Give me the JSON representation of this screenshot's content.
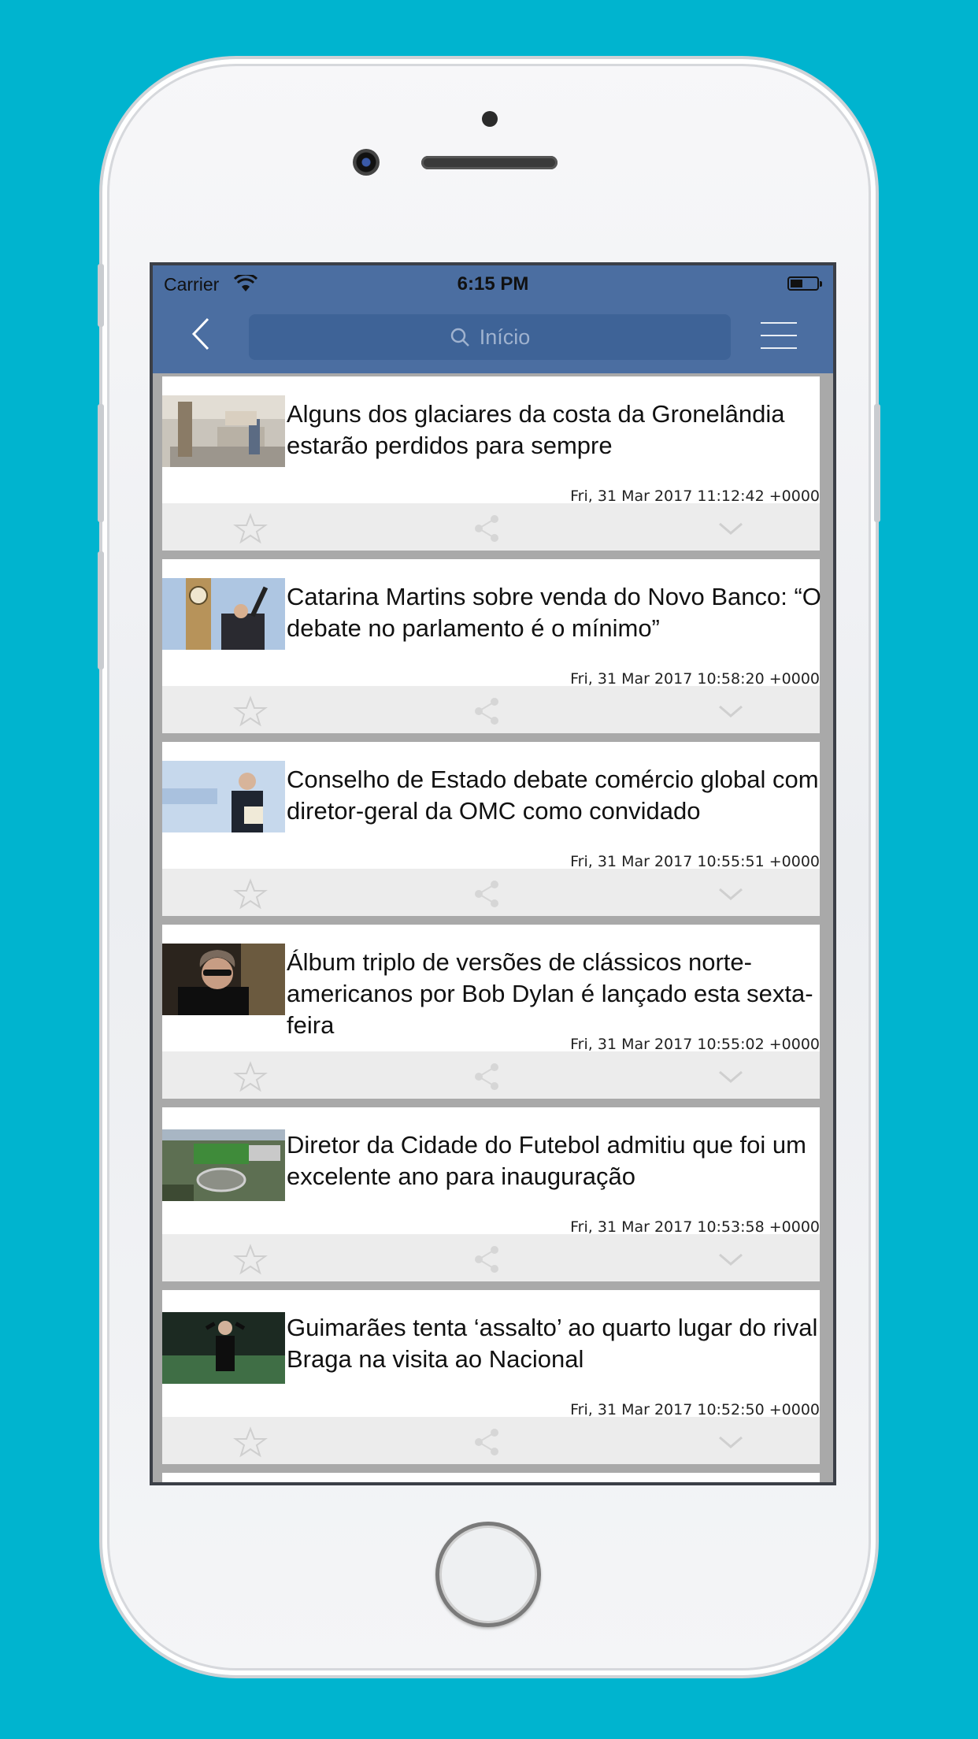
{
  "status_bar": {
    "carrier": "Carrier",
    "time": "6:15 PM"
  },
  "nav": {
    "search_placeholder": "Início",
    "icons": [
      "back-chevron-icon",
      "search-icon",
      "hamburger-menu-icon"
    ],
    "bar_color": "#4b6ea1"
  },
  "articles": [
    {
      "title": "Alguns dos glaciares da costa da Gronelândia estarão perdidos para sempre",
      "date": "Fri, 31 Mar 2017 11:12:42 +0000",
      "thumb": "museum-figures"
    },
    {
      "title": "Catarina Martins sobre venda do Novo Banco: “O debate no parlamento é o mínimo”",
      "date": "Fri, 31 Mar 2017 10:58:20 +0000",
      "thumb": "big-ben-bagpiper"
    },
    {
      "title": "Conselho de Estado debate comércio global com diretor-geral da OMC como convidado",
      "date": "Fri, 31 Mar 2017 10:55:51 +0000",
      "thumb": "man-in-suit-wto"
    },
    {
      "title": "Álbum triplo de versões de clássicos norte-americanos por Bob Dylan é lançado esta sexta-feira",
      "date": "Fri, 31 Mar 2017 10:55:02 +0000",
      "thumb": "man-with-sunglasses"
    },
    {
      "title": "Diretor da Cidade do Futebol admitiu que foi um excelente ano para inauguração",
      "date": "Fri, 31 Mar 2017 10:53:58 +0000",
      "thumb": "football-campus-aerial"
    },
    {
      "title": "Guimarães tenta ‘assalto’ ao quarto lugar do rival Braga na visita ao Nacional",
      "date": "Fri, 31 Mar 2017 10:52:50 +0000",
      "thumb": "coach-on-pitch"
    }
  ],
  "card_actions": [
    "star-icon",
    "share-icon",
    "chevron-down-icon"
  ]
}
